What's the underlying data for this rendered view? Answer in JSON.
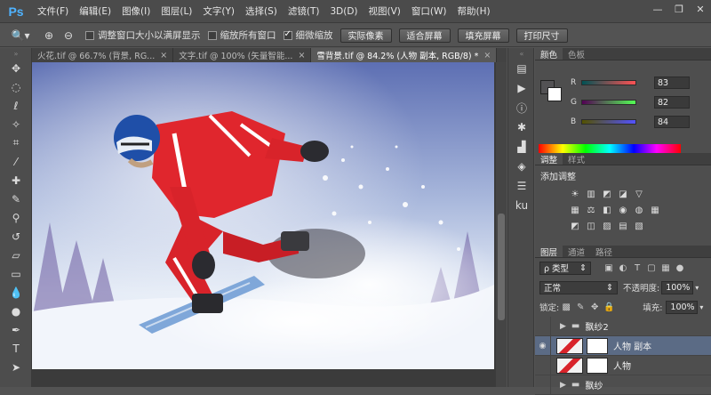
{
  "app": {
    "logo": "Ps"
  },
  "menu": [
    "文件(F)",
    "编辑(E)",
    "图像(I)",
    "图层(L)",
    "文字(Y)",
    "选择(S)",
    "滤镜(T)",
    "3D(D)",
    "视图(V)",
    "窗口(W)",
    "帮助(H)"
  ],
  "window_controls": {
    "minimize": "—",
    "restore": "❐",
    "close": "✕"
  },
  "options": {
    "resize_windows": "调整窗口大小以满屏显示",
    "zoom_all": "缩放所有窗口",
    "scrubby_zoom": "细微缩放",
    "btn_actual": "实际像素",
    "btn_fit": "适合屏幕",
    "btn_fill": "填充屏幕",
    "btn_print": "打印尺寸"
  },
  "tabs": [
    {
      "label": "火花.tif @ 66.7% (背景, RG...",
      "close": "×"
    },
    {
      "label": "文字.tif @ 100% (矢量智能...",
      "close": "×"
    },
    {
      "label": "雪背景.tif @ 84.2% (人物 副本, RGB/8) *",
      "close": "×"
    }
  ],
  "color_panel": {
    "tabs": [
      "颜色",
      "色板"
    ],
    "r_label": "R",
    "g_label": "G",
    "b_label": "B",
    "r": "83",
    "g": "82",
    "b": "84"
  },
  "adjust_panel": {
    "tabs": [
      "调整",
      "样式"
    ],
    "title": "添加调整",
    "row1": [
      "☀",
      "▥",
      "◩",
      "◪",
      "▽"
    ],
    "row2": [
      "▦",
      "⚖",
      "◧",
      "◉",
      "◍",
      "▦"
    ],
    "row3": [
      "◩",
      "◫",
      "▨",
      "▤",
      "▧"
    ]
  },
  "layers_panel": {
    "tabs": [
      "图层",
      "通道",
      "路径"
    ],
    "filter": "ρ 类型",
    "blend": "正常",
    "opacity_label": "不透明度:",
    "opacity": "100%",
    "lock_label": "锁定:",
    "fill_label": "填充:",
    "fill": "100%",
    "layers": [
      {
        "name": "飘纱2",
        "type": "group"
      },
      {
        "name": "人物 副本",
        "type": "layer",
        "selected": true
      },
      {
        "name": "人物",
        "type": "layer"
      },
      {
        "name": "飘纱",
        "type": "group"
      }
    ]
  },
  "colors": {
    "ps_blue": "#4fb3ff",
    "selection": "#5b6b85",
    "jacket_red": "#d8232a"
  }
}
